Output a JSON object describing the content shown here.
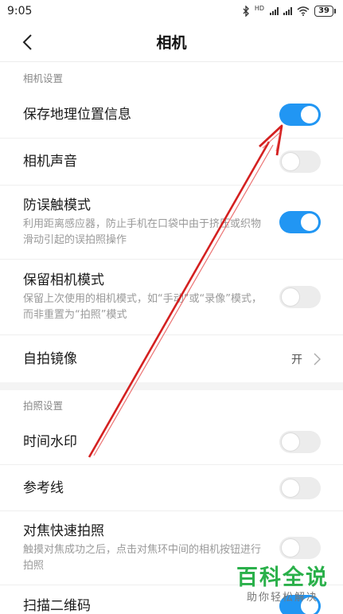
{
  "status_bar": {
    "time": "9:05",
    "network_label": "HD",
    "battery": "39",
    "colors": {
      "text": "#222222"
    }
  },
  "header": {
    "title": "相机"
  },
  "sections": [
    {
      "header": "相机设置"
    },
    {
      "header": "拍照设置"
    }
  ],
  "settings": {
    "save_location": {
      "title": "保存地理位置信息",
      "toggle": "on"
    },
    "camera_sound": {
      "title": "相机声音",
      "toggle": "off"
    },
    "anti_mistouch": {
      "title": "防误触模式",
      "desc": "利用距离感应器，防止手机在口袋中由于挤压或织物滑动引起的误拍照操作",
      "toggle": "on"
    },
    "keep_mode": {
      "title": "保留相机模式",
      "desc": "保留上次使用的相机模式，如“手动”或“录像”模式，而非重置为“拍照”模式",
      "toggle": "off"
    },
    "selfie_mirror": {
      "title": "自拍镜像",
      "value": "开"
    },
    "time_watermark": {
      "title": "时间水印",
      "toggle": "off"
    },
    "gridlines": {
      "title": "参考线",
      "toggle": "off"
    },
    "focus_shoot": {
      "title": "对焦快速拍照",
      "desc": "触摸对焦成功之后，点击对焦环中间的相机按钮进行拍照",
      "toggle": "off"
    },
    "scan_qr": {
      "title": "扫描二维码",
      "toggle": "on"
    }
  },
  "watermark": {
    "main": "百科全说",
    "sub": "助你轻松解决"
  },
  "annotation": {
    "type": "arrow",
    "color": "#d42020"
  },
  "colors": {
    "toggle_on": "#2196f3",
    "toggle_off": "#ececec",
    "brand_watermark": "#2ab04a"
  }
}
